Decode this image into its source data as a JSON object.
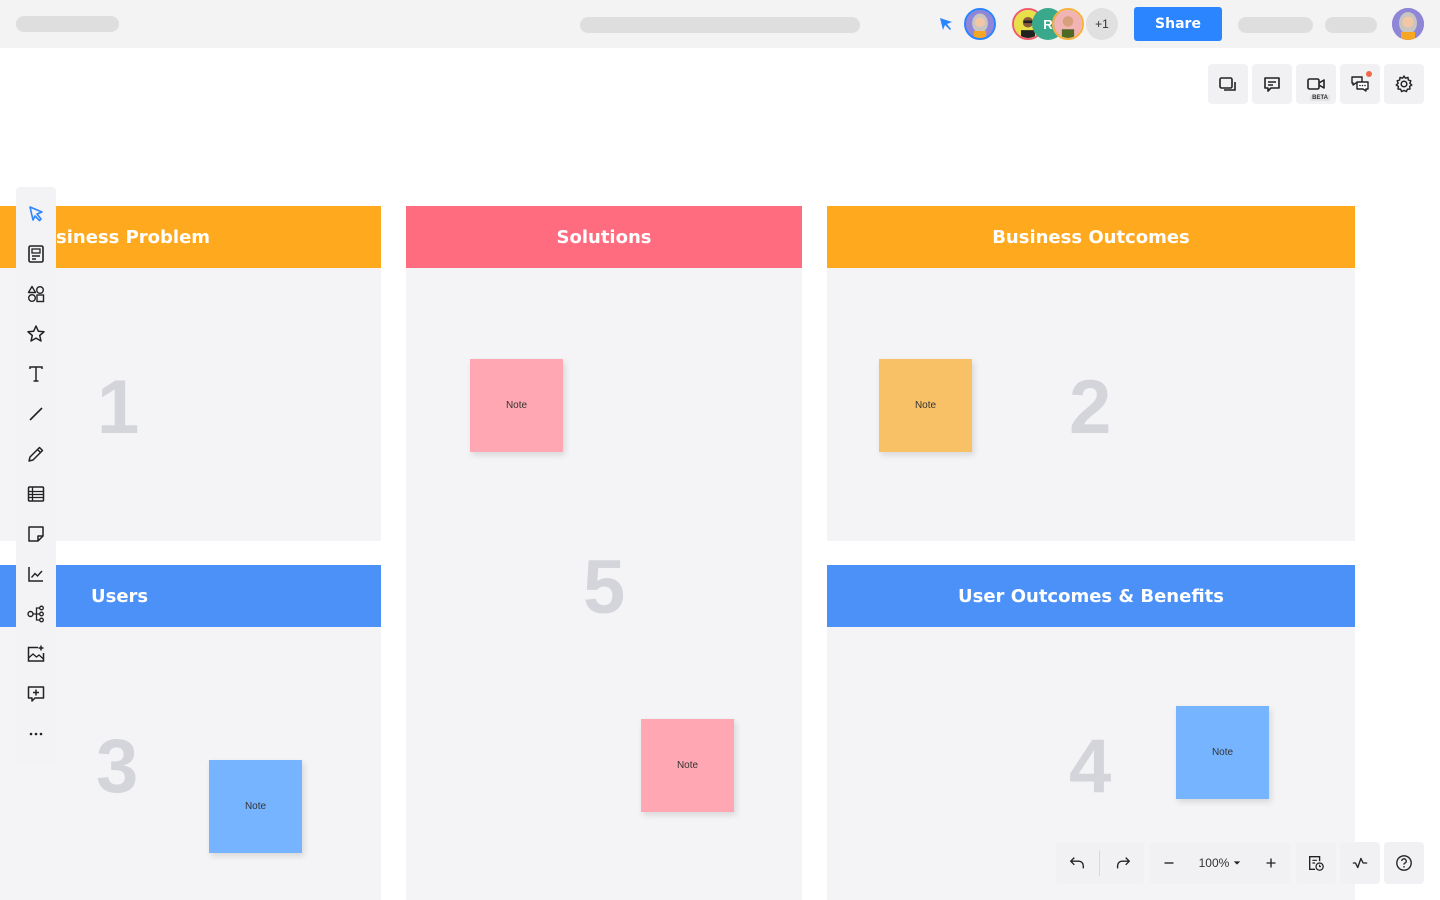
{
  "topbar": {
    "share_label": "Share",
    "collaborators": [
      {
        "name": "collaborator-1",
        "initial": "",
        "ring": "#ef5b6b"
      },
      {
        "name": "collaborator-2",
        "initial": "R",
        "bg": "#3aa88a"
      },
      {
        "name": "collaborator-3",
        "initial": "",
        "ring": "#f7b23b"
      }
    ],
    "more_collaborators": "+1"
  },
  "right_tools": [
    {
      "icon": "pages-icon",
      "label": "Pages"
    },
    {
      "icon": "comment-icon",
      "label": "Comments"
    },
    {
      "icon": "video-icon",
      "label": "Video",
      "badge": "BETA"
    },
    {
      "icon": "chat-icon",
      "label": "Chat",
      "notification": true
    },
    {
      "icon": "gear-icon",
      "label": "Settings"
    }
  ],
  "left_tools": [
    {
      "icon": "select-cursor-icon",
      "active": true
    },
    {
      "icon": "template-icon"
    },
    {
      "icon": "shapes-icon"
    },
    {
      "icon": "star-icon"
    },
    {
      "icon": "text-icon"
    },
    {
      "icon": "line-icon"
    },
    {
      "icon": "pencil-icon"
    },
    {
      "icon": "table-icon"
    },
    {
      "icon": "sticky-note-icon"
    },
    {
      "icon": "chart-icon"
    },
    {
      "icon": "mind-map-icon"
    },
    {
      "icon": "image-add-icon"
    },
    {
      "icon": "comment-add-icon"
    },
    {
      "icon": "more-icon"
    }
  ],
  "board": {
    "panels": [
      {
        "id": "business-problem",
        "title": "Business Problem",
        "visible_title": "siness Problem",
        "color": "#ffa91f",
        "number": "1"
      },
      {
        "id": "solutions",
        "title": "Solutions",
        "color": "#ff6b7f",
        "number": "5"
      },
      {
        "id": "business-outcomes",
        "title": "Business Outcomes",
        "color": "#ffa91f",
        "number": "2"
      },
      {
        "id": "users",
        "title": "Users",
        "color": "#4b91f7",
        "number": "3"
      },
      {
        "id": "user-outcomes",
        "title": "User Outcomes & Benefits",
        "color": "#4b91f7",
        "number": "4"
      }
    ],
    "notes": [
      {
        "text": "Note",
        "color": "#ffa7b2",
        "panel": "solutions"
      },
      {
        "text": "Note",
        "color": "#f9c166",
        "panel": "business-outcomes"
      },
      {
        "text": "Note",
        "color": "#ffa7b2",
        "panel": "solutions"
      },
      {
        "text": "Note",
        "color": "#77b4ff",
        "panel": "users"
      },
      {
        "text": "Note",
        "color": "#77b4ff",
        "panel": "user-outcomes"
      }
    ]
  },
  "bottom_bar": {
    "zoom_level": "100%",
    "undo": "Undo",
    "redo": "Redo"
  }
}
